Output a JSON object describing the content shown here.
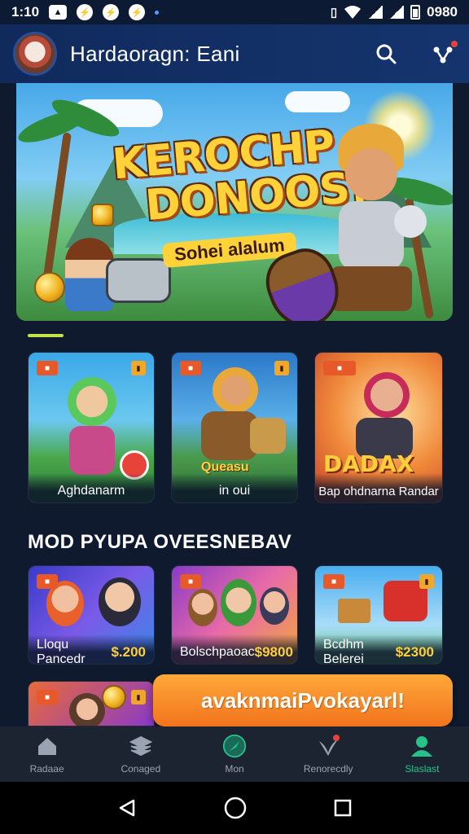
{
  "status_bar": {
    "time": "1:10",
    "right_text": "0980",
    "left_icons": [
      "gallery-icon",
      "messenger-icon",
      "messenger-icon",
      "messenger-icon"
    ],
    "right_icons": [
      "vibrate-icon",
      "wifi-icon",
      "signal-icon",
      "signal-icon",
      "battery-icon"
    ]
  },
  "header": {
    "title": "Hardaoragn: Eani",
    "icons": [
      "search-icon",
      "share-icon"
    ]
  },
  "hero": {
    "title_line1": "KEROCHP",
    "title_line2": "DONOOS!",
    "subtitle": "Sohei alalum"
  },
  "featured_cards": [
    {
      "caption": "Aghdanarm",
      "badge": "■"
    },
    {
      "caption": "in oui",
      "tag": "Queasu",
      "badge": "■"
    },
    {
      "caption": "Bap ohdnarna Randar",
      "tag": "DADAX",
      "badge": "■"
    }
  ],
  "section": {
    "title": "MOD PYUPA OVEESNEBAV"
  },
  "shop_cards": [
    {
      "name": "Lloqu Pancedr",
      "price": "$.200"
    },
    {
      "name": "Bolschpaoac",
      "price": "$9800"
    },
    {
      "name": "Bcdhm Belerei",
      "price": "$2300"
    }
  ],
  "cta": {
    "label": "avaknmaiPvokayarl!"
  },
  "bottom_nav": [
    {
      "label": "Radaae",
      "icon": "home-icon",
      "active": false
    },
    {
      "label": "Conaged",
      "icon": "layers-icon",
      "active": false
    },
    {
      "label": "Mon",
      "icon": "compass-icon",
      "active": false
    },
    {
      "label": "Renorecdly",
      "icon": "bird-icon",
      "active": false
    },
    {
      "label": "Slaslast",
      "icon": "profile-icon",
      "active": true
    }
  ],
  "colors": {
    "accent": "#27c28a",
    "cta": "#f2731c",
    "header": "#15346e",
    "price": "#ffcf3a",
    "indicator": "#c5e04a"
  }
}
